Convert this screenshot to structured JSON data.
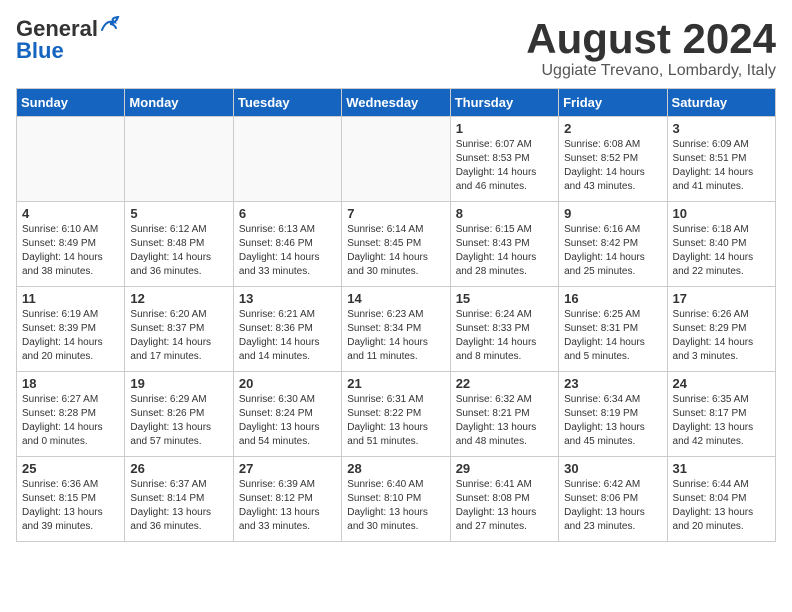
{
  "header": {
    "logo_general": "General",
    "logo_blue": "Blue",
    "month_title": "August 2024",
    "location": "Uggiate Trevano, Lombardy, Italy"
  },
  "days_of_week": [
    "Sunday",
    "Monday",
    "Tuesday",
    "Wednesday",
    "Thursday",
    "Friday",
    "Saturday"
  ],
  "weeks": [
    [
      {
        "day": "",
        "info": ""
      },
      {
        "day": "",
        "info": ""
      },
      {
        "day": "",
        "info": ""
      },
      {
        "day": "",
        "info": ""
      },
      {
        "day": "1",
        "info": "Sunrise: 6:07 AM\nSunset: 8:53 PM\nDaylight: 14 hours\nand 46 minutes."
      },
      {
        "day": "2",
        "info": "Sunrise: 6:08 AM\nSunset: 8:52 PM\nDaylight: 14 hours\nand 43 minutes."
      },
      {
        "day": "3",
        "info": "Sunrise: 6:09 AM\nSunset: 8:51 PM\nDaylight: 14 hours\nand 41 minutes."
      }
    ],
    [
      {
        "day": "4",
        "info": "Sunrise: 6:10 AM\nSunset: 8:49 PM\nDaylight: 14 hours\nand 38 minutes."
      },
      {
        "day": "5",
        "info": "Sunrise: 6:12 AM\nSunset: 8:48 PM\nDaylight: 14 hours\nand 36 minutes."
      },
      {
        "day": "6",
        "info": "Sunrise: 6:13 AM\nSunset: 8:46 PM\nDaylight: 14 hours\nand 33 minutes."
      },
      {
        "day": "7",
        "info": "Sunrise: 6:14 AM\nSunset: 8:45 PM\nDaylight: 14 hours\nand 30 minutes."
      },
      {
        "day": "8",
        "info": "Sunrise: 6:15 AM\nSunset: 8:43 PM\nDaylight: 14 hours\nand 28 minutes."
      },
      {
        "day": "9",
        "info": "Sunrise: 6:16 AM\nSunset: 8:42 PM\nDaylight: 14 hours\nand 25 minutes."
      },
      {
        "day": "10",
        "info": "Sunrise: 6:18 AM\nSunset: 8:40 PM\nDaylight: 14 hours\nand 22 minutes."
      }
    ],
    [
      {
        "day": "11",
        "info": "Sunrise: 6:19 AM\nSunset: 8:39 PM\nDaylight: 14 hours\nand 20 minutes."
      },
      {
        "day": "12",
        "info": "Sunrise: 6:20 AM\nSunset: 8:37 PM\nDaylight: 14 hours\nand 17 minutes."
      },
      {
        "day": "13",
        "info": "Sunrise: 6:21 AM\nSunset: 8:36 PM\nDaylight: 14 hours\nand 14 minutes."
      },
      {
        "day": "14",
        "info": "Sunrise: 6:23 AM\nSunset: 8:34 PM\nDaylight: 14 hours\nand 11 minutes."
      },
      {
        "day": "15",
        "info": "Sunrise: 6:24 AM\nSunset: 8:33 PM\nDaylight: 14 hours\nand 8 minutes."
      },
      {
        "day": "16",
        "info": "Sunrise: 6:25 AM\nSunset: 8:31 PM\nDaylight: 14 hours\nand 5 minutes."
      },
      {
        "day": "17",
        "info": "Sunrise: 6:26 AM\nSunset: 8:29 PM\nDaylight: 14 hours\nand 3 minutes."
      }
    ],
    [
      {
        "day": "18",
        "info": "Sunrise: 6:27 AM\nSunset: 8:28 PM\nDaylight: 14 hours\nand 0 minutes."
      },
      {
        "day": "19",
        "info": "Sunrise: 6:29 AM\nSunset: 8:26 PM\nDaylight: 13 hours\nand 57 minutes."
      },
      {
        "day": "20",
        "info": "Sunrise: 6:30 AM\nSunset: 8:24 PM\nDaylight: 13 hours\nand 54 minutes."
      },
      {
        "day": "21",
        "info": "Sunrise: 6:31 AM\nSunset: 8:22 PM\nDaylight: 13 hours\nand 51 minutes."
      },
      {
        "day": "22",
        "info": "Sunrise: 6:32 AM\nSunset: 8:21 PM\nDaylight: 13 hours\nand 48 minutes."
      },
      {
        "day": "23",
        "info": "Sunrise: 6:34 AM\nSunset: 8:19 PM\nDaylight: 13 hours\nand 45 minutes."
      },
      {
        "day": "24",
        "info": "Sunrise: 6:35 AM\nSunset: 8:17 PM\nDaylight: 13 hours\nand 42 minutes."
      }
    ],
    [
      {
        "day": "25",
        "info": "Sunrise: 6:36 AM\nSunset: 8:15 PM\nDaylight: 13 hours\nand 39 minutes."
      },
      {
        "day": "26",
        "info": "Sunrise: 6:37 AM\nSunset: 8:14 PM\nDaylight: 13 hours\nand 36 minutes."
      },
      {
        "day": "27",
        "info": "Sunrise: 6:39 AM\nSunset: 8:12 PM\nDaylight: 13 hours\nand 33 minutes."
      },
      {
        "day": "28",
        "info": "Sunrise: 6:40 AM\nSunset: 8:10 PM\nDaylight: 13 hours\nand 30 minutes."
      },
      {
        "day": "29",
        "info": "Sunrise: 6:41 AM\nSunset: 8:08 PM\nDaylight: 13 hours\nand 27 minutes."
      },
      {
        "day": "30",
        "info": "Sunrise: 6:42 AM\nSunset: 8:06 PM\nDaylight: 13 hours\nand 23 minutes."
      },
      {
        "day": "31",
        "info": "Sunrise: 6:44 AM\nSunset: 8:04 PM\nDaylight: 13 hours\nand 20 minutes."
      }
    ]
  ]
}
